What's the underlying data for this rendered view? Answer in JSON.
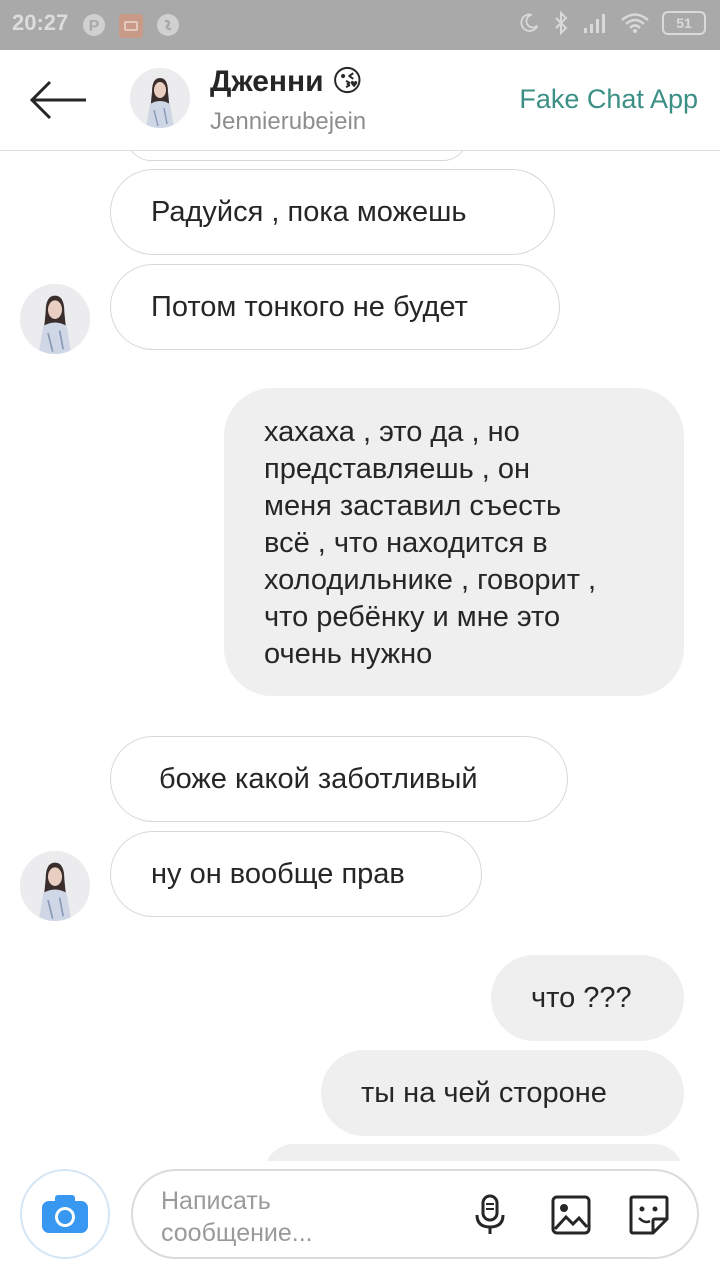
{
  "status_bar": {
    "time": "20:27",
    "battery": "51",
    "icons": [
      "pinterest-icon",
      "mi-icon",
      "shazam-icon",
      "moon-icon",
      "bluetooth-icon",
      "signal-icon",
      "wifi-icon",
      "battery-icon"
    ]
  },
  "header": {
    "contact_name": "Дженни",
    "contact_emoji": "😘",
    "contact_handle": "Jennierubejein",
    "app_label": "Fake Chat App",
    "back_icon": "arrow-left-icon"
  },
  "messages": [
    {
      "id": 1,
      "side": "in",
      "text": "Радуйся , пока можешь"
    },
    {
      "id": 2,
      "side": "in",
      "text": "Потом тонкого не будет",
      "avatar": true
    },
    {
      "id": 3,
      "side": "out",
      "lines": [
        "хахаха , это да , но",
        "представляешь , он",
        "меня заставил съесть",
        "всё , что находится в",
        "холодильнике , говорит ,",
        "что ребёнку и мне это",
        "очень нужно"
      ]
    },
    {
      "id": 4,
      "side": "in",
      "text": "боже какой заботливый"
    },
    {
      "id": 5,
      "side": "in",
      "text": "ну он вообще прав",
      "avatar": true
    },
    {
      "id": 6,
      "side": "out",
      "text": "что ???"
    },
    {
      "id": 7,
      "side": "out",
      "text": "ты на чей стороне"
    }
  ],
  "composer": {
    "placeholder": "Написать сообщение...",
    "camera_icon": "camera-icon",
    "mic_icon": "microphone-icon",
    "gallery_icon": "image-icon",
    "sticker_icon": "sticker-icon"
  },
  "colors": {
    "status_bar": "#a9a9a9",
    "accent_app": "#3b8f85",
    "camera_blue": "#3897f0",
    "out_bubble": "#efefef",
    "in_border": "#d8d8d8"
  }
}
